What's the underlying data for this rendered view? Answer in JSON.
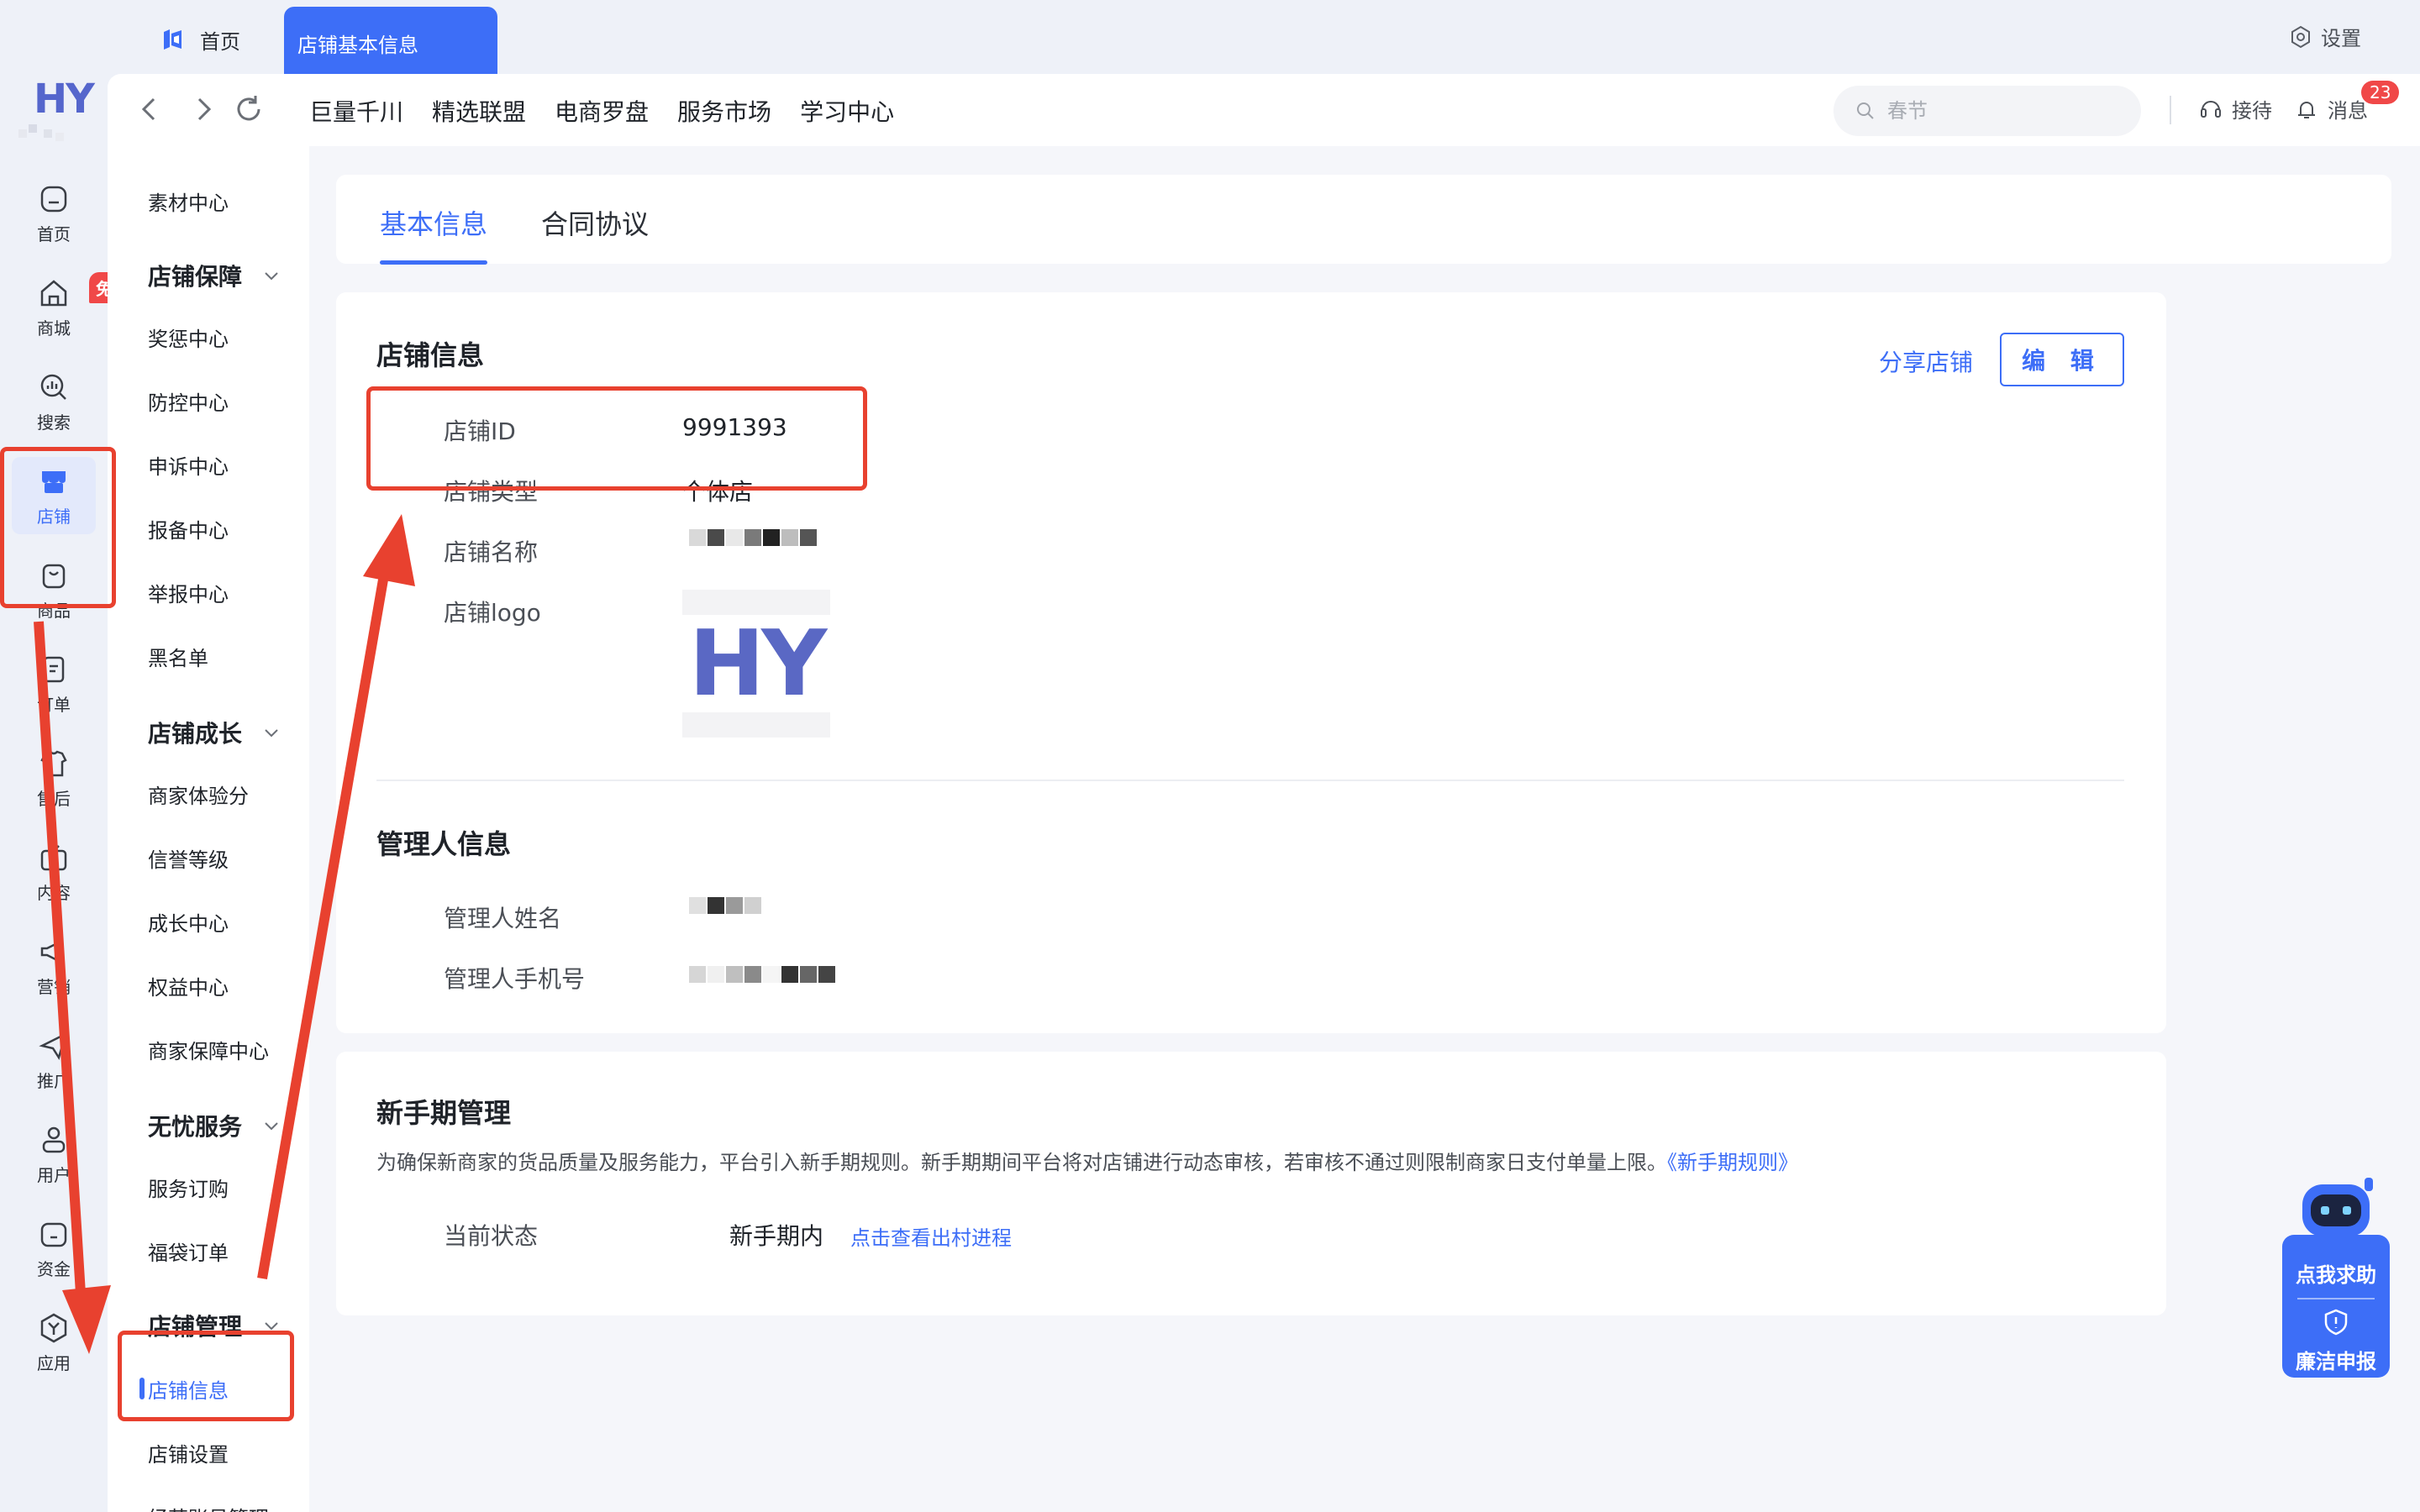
{
  "tabs": {
    "home": "首页",
    "active": "店铺基本信息"
  },
  "settings_label": "设置",
  "rail_logo": "HY",
  "rail": [
    {
      "key": "home",
      "label": "首页"
    },
    {
      "key": "mall",
      "label": "商城"
    },
    {
      "key": "search",
      "label": "搜索"
    },
    {
      "key": "shop",
      "label": "店铺"
    },
    {
      "key": "goods",
      "label": "商品"
    },
    {
      "key": "order",
      "label": "订单"
    },
    {
      "key": "aftersale",
      "label": "售后"
    },
    {
      "key": "content",
      "label": "内容"
    },
    {
      "key": "marketing",
      "label": "营销"
    },
    {
      "key": "promo",
      "label": "推广"
    },
    {
      "key": "user",
      "label": "用户"
    },
    {
      "key": "funds",
      "label": "资金"
    },
    {
      "key": "apps",
      "label": "应用"
    }
  ],
  "rail_badge": "免佣",
  "nav": {
    "links": [
      "巨量千川",
      "精选联盟",
      "电商罗盘",
      "服务市场",
      "学习中心"
    ],
    "search_placeholder": "春节",
    "reception": "接待",
    "messages": "消息",
    "message_count": "23"
  },
  "submenu": {
    "item_top": "素材中心",
    "group1": "店铺保障",
    "group1_items": [
      "奖惩中心",
      "防控中心",
      "申诉中心",
      "报备中心",
      "举报中心",
      "黑名单"
    ],
    "group2": "店铺成长",
    "group2_items": [
      "商家体验分",
      "信誉等级",
      "成长中心",
      "权益中心",
      "商家保障中心"
    ],
    "group3": "无忧服务",
    "group3_items": [
      "服务订购",
      "福袋订单"
    ],
    "group4": "店铺管理",
    "group4_items": [
      "店铺信息",
      "店铺设置",
      "经营账号管理"
    ]
  },
  "content_tabs": [
    "基本信息",
    "合同协议"
  ],
  "shop_info": {
    "title": "店铺信息",
    "share_label": "分享店铺",
    "edit_label": "编 辑",
    "id_label": "店铺ID",
    "id_value": "9991393",
    "type_label": "店铺类型",
    "type_value": "个体店",
    "name_label": "店铺名称",
    "logo_label": "店铺logo",
    "logo_text": "HY"
  },
  "manager_info": {
    "title": "管理人信息",
    "name_label": "管理人姓名",
    "phone_label": "管理人手机号"
  },
  "newbie": {
    "title": "新手期管理",
    "desc": "为确保新商家的货品质量及服务能力，平台引入新手期规则。新手期期间平台将对店铺进行动态审核，若审核不通过则限制商家日支付单量上限。",
    "rule_link": "《新手期规则》",
    "status_label": "当前状态",
    "status_value": "新手期内",
    "progress_link": "点击查看出村进程"
  },
  "helper": {
    "help": "点我求助",
    "report": "廉洁申报"
  },
  "colors": {
    "accent": "#3d6ef7",
    "annotation": "#e8412f",
    "badge": "#f04848"
  }
}
